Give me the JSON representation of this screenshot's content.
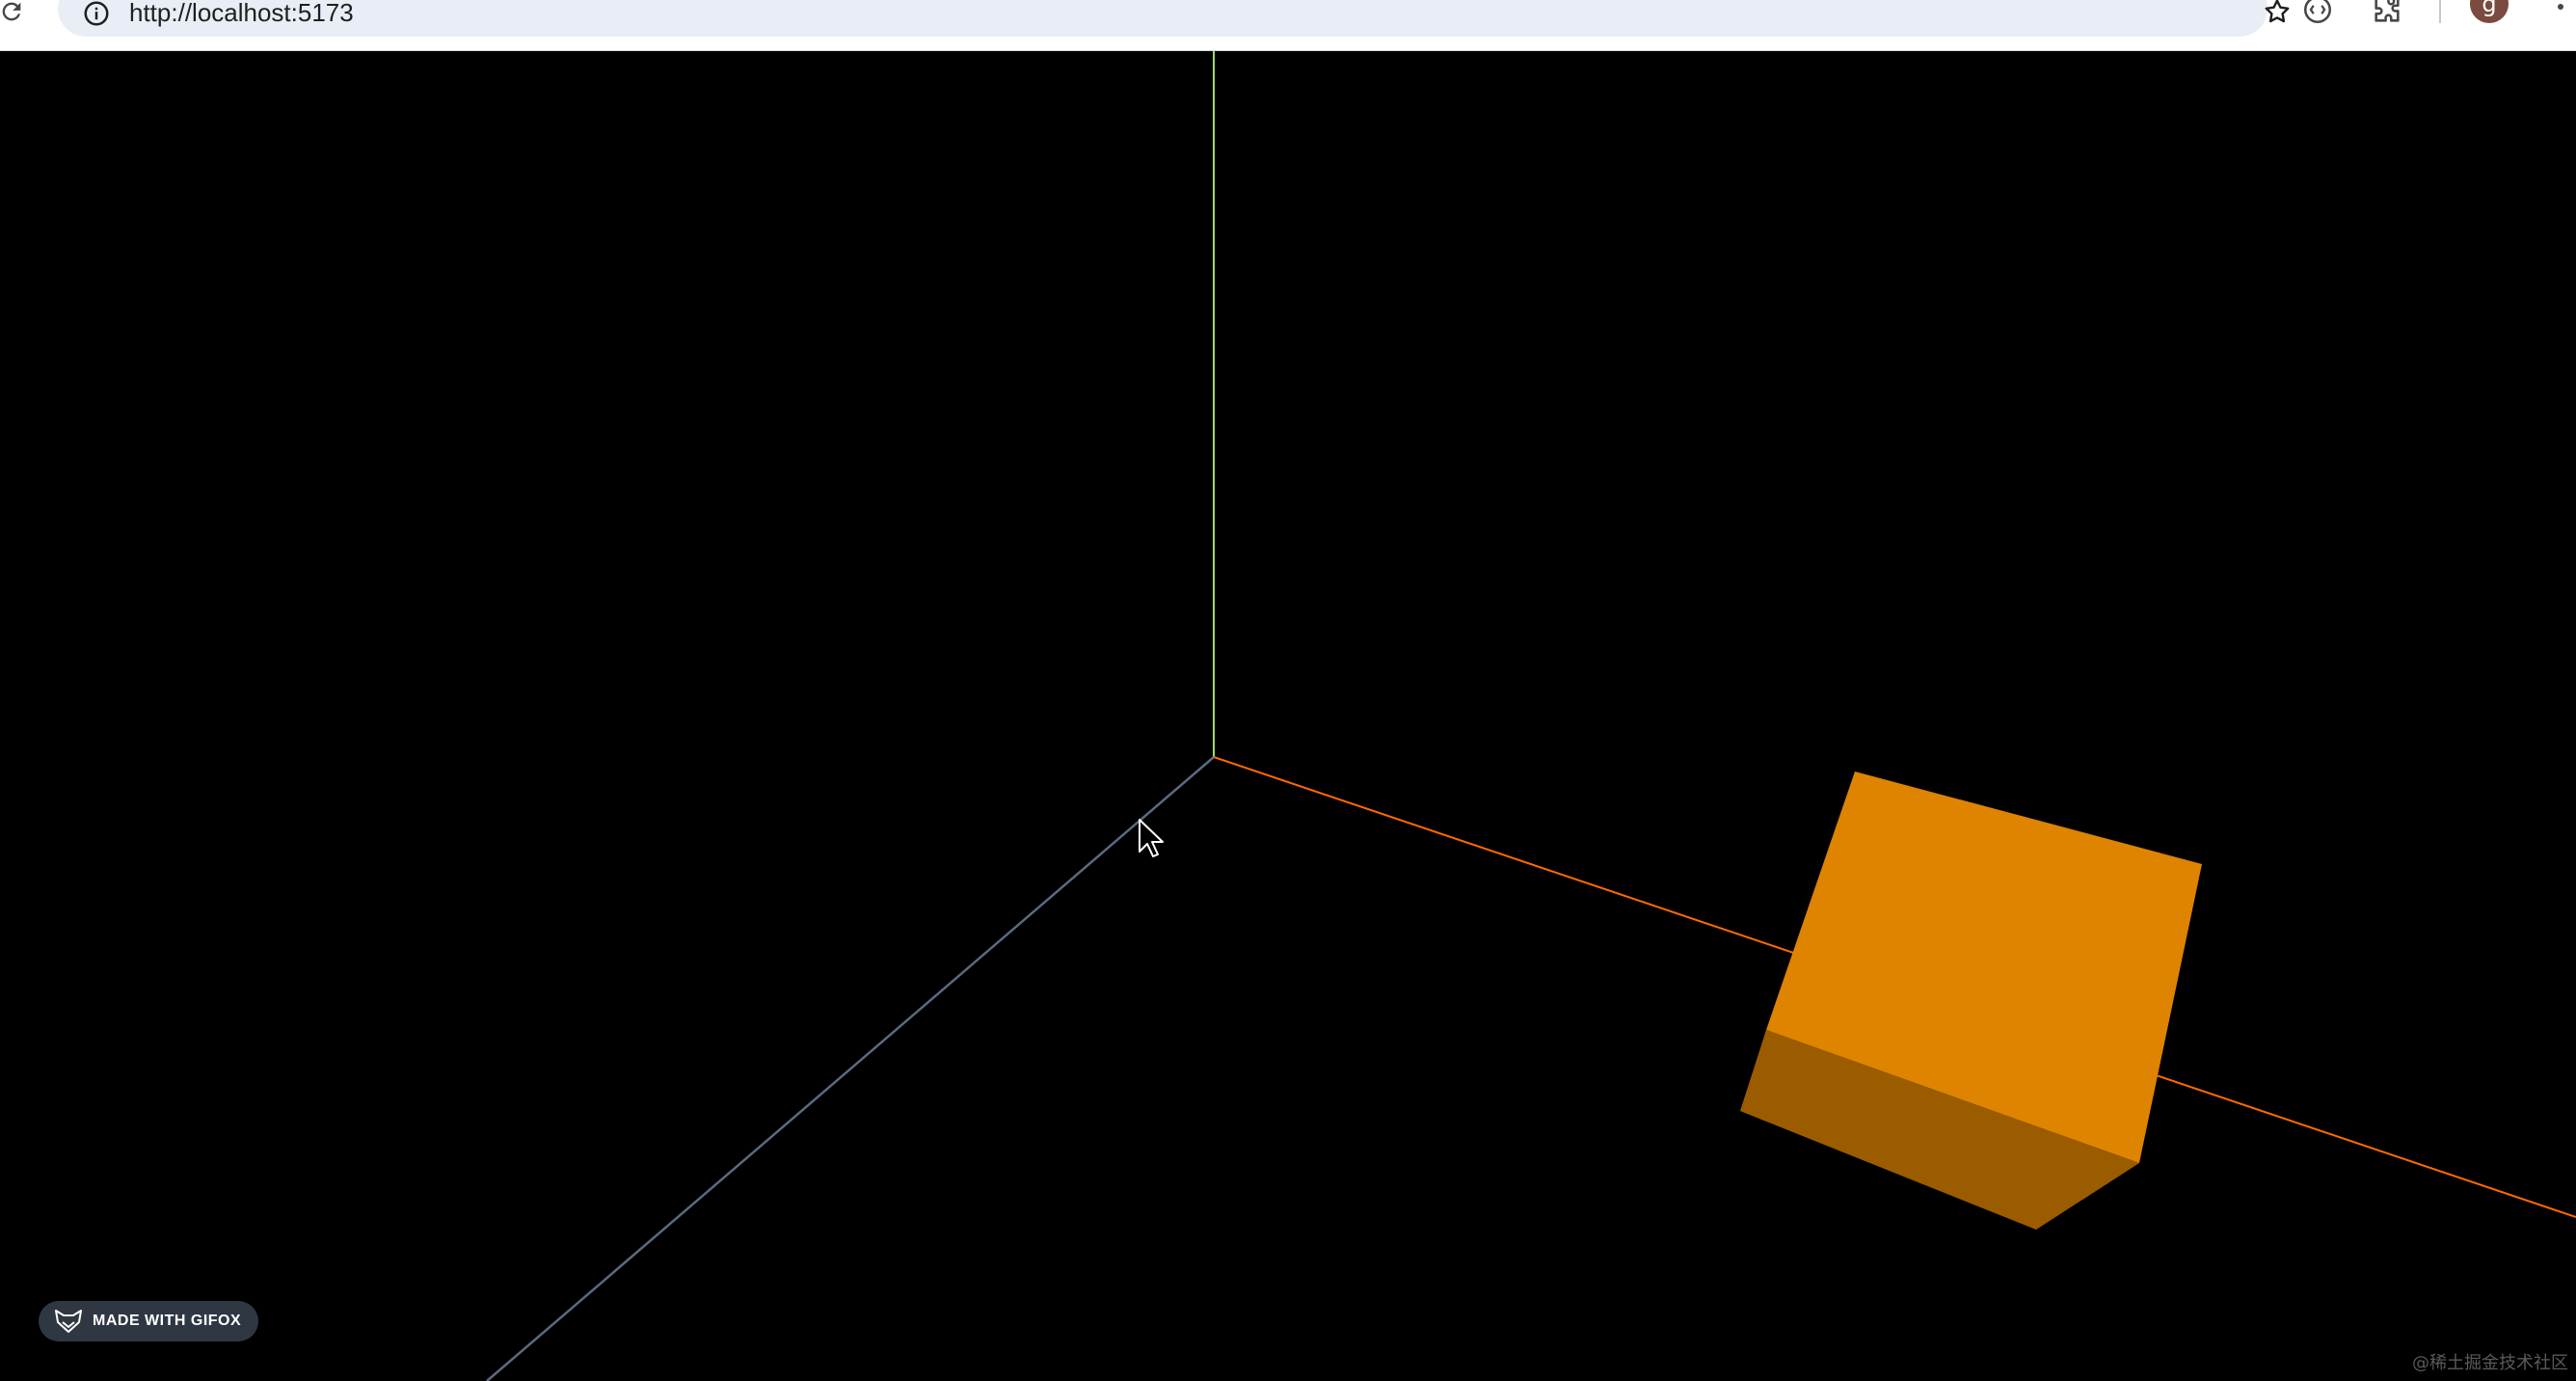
{
  "browser": {
    "url": "http://localhost:5173",
    "avatar_letter": "g",
    "icons": {
      "reload": "reload-icon",
      "site_info": "info-icon",
      "bookmark": "star-icon",
      "extension": "extension-icon",
      "puzzle": "puzzle-icon",
      "menu": "more-vertical-icon"
    }
  },
  "scene": {
    "background": "#000000",
    "axes": {
      "x_color": "#ff6a00",
      "y_color": "#9ddc6a",
      "z_color": "#5a6a80"
    },
    "cube": {
      "front_color": "#de8400",
      "bottom_color": "#9b5c00"
    }
  },
  "overlay": {
    "badge_label": "MADE WITH GIFOX",
    "watermark": "@稀土掘金技术社区"
  }
}
